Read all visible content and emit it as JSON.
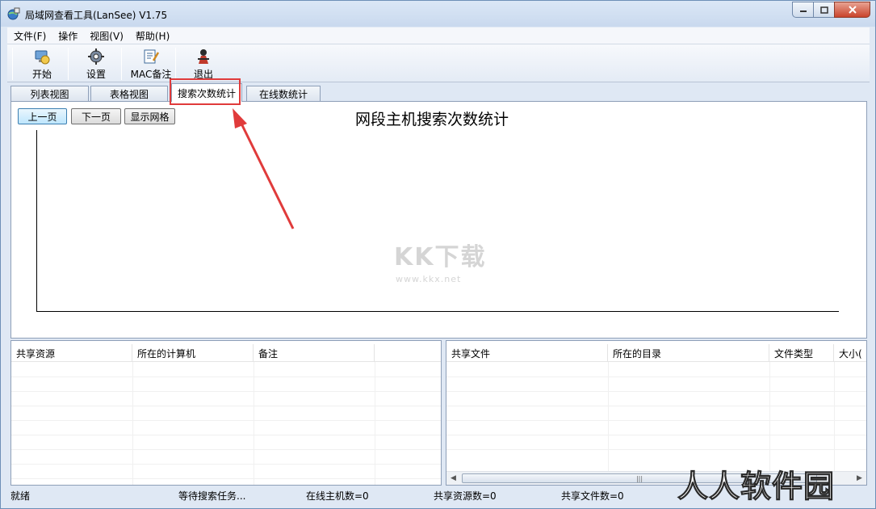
{
  "window": {
    "title": "局域网查看工具(LanSee) V1.75",
    "controls": [
      "minimize",
      "maximize",
      "close"
    ]
  },
  "menu": {
    "items": [
      "文件(F)",
      "操作",
      "视图(V)",
      "帮助(H)"
    ]
  },
  "toolbar": {
    "buttons": [
      {
        "label": "开始",
        "icon": "start-icon"
      },
      {
        "label": "设置",
        "icon": "settings-icon"
      },
      {
        "label": "MAC备注",
        "icon": "mac-note-icon"
      },
      {
        "label": "退出",
        "icon": "exit-icon"
      }
    ]
  },
  "tabs": {
    "items": [
      "列表视图",
      "表格视图",
      "搜索次数统计",
      "在线数统计"
    ],
    "active": "搜索次数统计"
  },
  "chart_panel": {
    "buttons": [
      "上一页",
      "下一页",
      "显示网格"
    ],
    "title": "网段主机搜索次数统计"
  },
  "watermark": {
    "main": "KK下载",
    "url": "www.kkx.net"
  },
  "shares_list": {
    "columns": [
      "共享资源",
      "所在的计算机",
      "备注"
    ]
  },
  "files_list": {
    "columns": [
      "共享文件",
      "所在的目录",
      "文件类型",
      "大小("
    ]
  },
  "status": {
    "ready": "就绪",
    "task": "等待搜索任务...",
    "online_hosts": "在线主机数=0",
    "shared_resources": "共享资源数=0",
    "shared_files": "共享文件数=0"
  },
  "corner_watermark": "人人软件园",
  "colors": {
    "annotation": "#e03b3b",
    "frame": "#dfe8f4"
  }
}
